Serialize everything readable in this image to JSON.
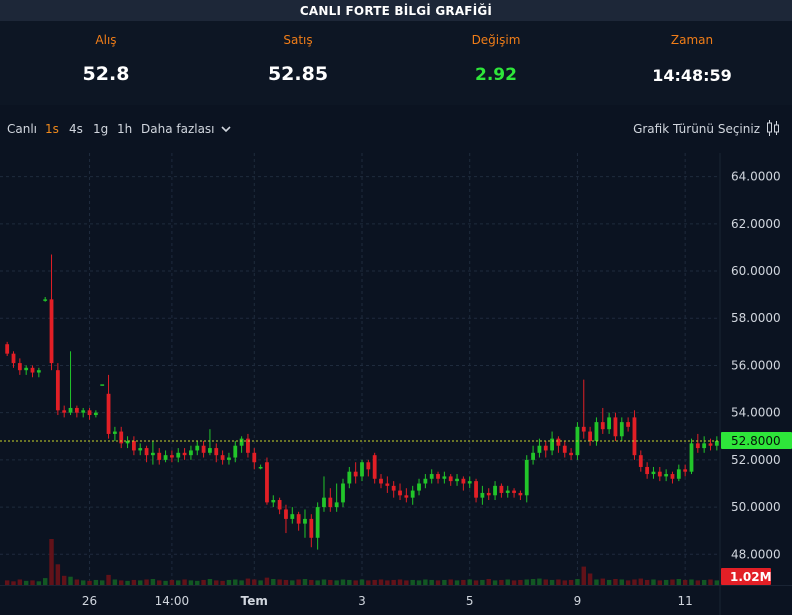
{
  "title": "CANLI FORTE BİLGİ GRAFİĞİ",
  "stats": [
    {
      "label": "Alış",
      "value": "52.8"
    },
    {
      "label": "Satış",
      "value": "52.85"
    },
    {
      "label": "Değişim",
      "value": "2.92"
    },
    {
      "label": "Zaman",
      "value": "14:48:59"
    }
  ],
  "toolbar": {
    "live": "Canlı",
    "intervals": [
      "1s",
      "4s",
      "1g",
      "1h"
    ],
    "active_interval": "1s",
    "more": "Daha fazlası",
    "chart_type": "Grafik Türünü Seçiniz"
  },
  "colors": {
    "up": "#22c52a",
    "down": "#e21f26",
    "accent": "#f07d18",
    "price_tag": "#2ee63a",
    "volume_tag": "#e21f26",
    "background": "#0b1321"
  },
  "icons": {
    "more": "chevron-down-icon",
    "chart_type": "candlestick-icon"
  },
  "chart_data": {
    "type": "candlestick",
    "y_ticks": [
      "64.0000",
      "62.0000",
      "60.0000",
      "58.0000",
      "56.0000",
      "54.0000",
      "52.0000",
      "50.0000",
      "48.0000"
    ],
    "ylim": [
      46.7,
      65.0
    ],
    "x_ticks": [
      "26",
      "14:00",
      "Tem",
      "3",
      "5",
      "9",
      "11"
    ],
    "x_tick_index": [
      13,
      26,
      39,
      56,
      73,
      90,
      107
    ],
    "last_price_label": "52.8000",
    "last_price": 52.8,
    "volume_label": "1.02M",
    "grid": true,
    "candles": [
      [
        56.9,
        56.5,
        57.0,
        56.4
      ],
      [
        56.5,
        56.1,
        56.6,
        55.9
      ],
      [
        56.1,
        55.8,
        56.3,
        55.6
      ],
      [
        55.8,
        55.9,
        56.0,
        55.6
      ],
      [
        55.9,
        55.7,
        56.0,
        55.5
      ],
      [
        55.7,
        55.8,
        55.9,
        55.5
      ],
      [
        58.8,
        58.8,
        58.9,
        58.7
      ],
      [
        58.8,
        56.1,
        60.7,
        55.8
      ],
      [
        55.8,
        54.1,
        56.1,
        53.9
      ],
      [
        54.1,
        54.0,
        54.3,
        53.8
      ],
      [
        54.0,
        54.2,
        56.6,
        53.9
      ],
      [
        54.2,
        54.0,
        54.3,
        53.8
      ],
      [
        54.0,
        54.1,
        54.2,
        53.8
      ],
      [
        54.1,
        53.9,
        54.2,
        53.7
      ],
      [
        53.9,
        54.0,
        54.1,
        53.8
      ],
      [
        55.2,
        55.2,
        55.2,
        55.2
      ],
      [
        54.8,
        53.1,
        55.6,
        52.9
      ],
      [
        53.1,
        53.2,
        53.4,
        52.8
      ],
      [
        53.2,
        52.7,
        53.4,
        52.5
      ],
      [
        52.7,
        52.8,
        53.0,
        52.5
      ],
      [
        52.8,
        52.4,
        53.0,
        52.2
      ],
      [
        52.4,
        52.5,
        52.7,
        52.2
      ],
      [
        52.5,
        52.2,
        52.6,
        51.9
      ],
      [
        52.2,
        52.3,
        52.8,
        51.8
      ],
      [
        52.3,
        52.0,
        52.5,
        51.8
      ],
      [
        52.0,
        52.2,
        52.4,
        51.9
      ],
      [
        52.2,
        52.1,
        52.4,
        51.9
      ],
      [
        52.1,
        52.3,
        52.5,
        51.9
      ],
      [
        52.3,
        52.2,
        52.5,
        52.0
      ],
      [
        52.2,
        52.4,
        52.6,
        52.0
      ],
      [
        52.4,
        52.6,
        52.8,
        52.2
      ],
      [
        52.6,
        52.3,
        52.8,
        52.1
      ],
      [
        52.3,
        52.5,
        53.3,
        52.2
      ],
      [
        52.5,
        52.2,
        52.7,
        51.9
      ],
      [
        52.2,
        52.0,
        52.4,
        51.8
      ],
      [
        52.0,
        52.1,
        52.3,
        51.8
      ],
      [
        52.1,
        52.6,
        52.8,
        51.9
      ],
      [
        52.6,
        52.9,
        53.0,
        52.3
      ],
      [
        52.9,
        52.3,
        53.1,
        52.1
      ],
      [
        52.3,
        51.9,
        52.5,
        51.6
      ],
      [
        51.7,
        51.7,
        51.8,
        51.6
      ],
      [
        51.9,
        50.2,
        52.1,
        50.1
      ],
      [
        50.2,
        50.3,
        50.5,
        50.0
      ],
      [
        50.3,
        49.9,
        50.4,
        49.7
      ],
      [
        49.9,
        49.5,
        50.1,
        48.9
      ],
      [
        49.5,
        49.7,
        50.0,
        49.3
      ],
      [
        49.7,
        49.3,
        49.8,
        49.0
      ],
      [
        49.3,
        49.5,
        49.9,
        48.7
      ],
      [
        49.5,
        48.7,
        49.7,
        48.3
      ],
      [
        48.7,
        50.0,
        50.2,
        48.2
      ],
      [
        50.0,
        50.4,
        51.3,
        49.8
      ],
      [
        50.4,
        50.0,
        50.8,
        49.8
      ],
      [
        50.0,
        50.2,
        51.0,
        49.8
      ],
      [
        50.2,
        51.0,
        51.2,
        50.0
      ],
      [
        51.0,
        51.5,
        51.7,
        50.8
      ],
      [
        51.5,
        51.3,
        51.9,
        51.0
      ],
      [
        51.3,
        51.9,
        52.0,
        51.1
      ],
      [
        51.9,
        51.6,
        52.0,
        51.3
      ],
      [
        52.2,
        51.2,
        52.3,
        51.0
      ],
      [
        51.2,
        51.0,
        51.4,
        50.8
      ],
      [
        51.0,
        50.9,
        51.3,
        50.6
      ],
      [
        50.9,
        50.7,
        51.1,
        50.4
      ],
      [
        50.7,
        50.5,
        51.0,
        50.3
      ],
      [
        50.5,
        50.4,
        50.8,
        50.2
      ],
      [
        50.4,
        50.7,
        50.9,
        50.1
      ],
      [
        50.7,
        51.0,
        51.2,
        50.5
      ],
      [
        51.0,
        51.2,
        51.4,
        50.8
      ],
      [
        51.2,
        51.4,
        51.6,
        51.0
      ],
      [
        51.4,
        51.2,
        51.5,
        51.0
      ],
      [
        51.2,
        51.3,
        51.5,
        51.0
      ],
      [
        51.3,
        51.1,
        51.4,
        50.9
      ],
      [
        51.1,
        51.2,
        51.4,
        50.9
      ],
      [
        51.2,
        51.0,
        51.3,
        50.7
      ],
      [
        51.0,
        51.1,
        51.3,
        50.8
      ],
      [
        51.1,
        50.4,
        51.2,
        50.2
      ],
      [
        50.4,
        50.6,
        50.9,
        50.1
      ],
      [
        50.6,
        50.5,
        50.8,
        50.3
      ],
      [
        50.5,
        50.9,
        51.1,
        50.3
      ],
      [
        50.9,
        50.6,
        51.0,
        50.4
      ],
      [
        50.6,
        50.7,
        50.9,
        50.4
      ],
      [
        50.7,
        50.6,
        50.8,
        50.4
      ],
      [
        50.6,
        50.5,
        50.7,
        50.3
      ],
      [
        50.5,
        52.0,
        52.2,
        50.2
      ],
      [
        52.0,
        52.3,
        52.6,
        51.8
      ],
      [
        52.3,
        52.6,
        52.9,
        52.1
      ],
      [
        52.6,
        52.4,
        52.8,
        52.1
      ],
      [
        52.4,
        52.9,
        53.2,
        52.2
      ],
      [
        52.9,
        52.6,
        53.0,
        52.3
      ],
      [
        52.6,
        52.3,
        52.8,
        52.1
      ],
      [
        52.3,
        52.2,
        52.5,
        52.0
      ],
      [
        52.2,
        53.4,
        53.6,
        52.0
      ],
      [
        53.4,
        53.2,
        55.4,
        52.9
      ],
      [
        53.2,
        52.8,
        53.4,
        52.6
      ],
      [
        52.8,
        53.6,
        53.8,
        52.6
      ],
      [
        53.6,
        53.3,
        54.2,
        53.1
      ],
      [
        53.3,
        53.8,
        54.0,
        53.1
      ],
      [
        53.8,
        53.0,
        54.0,
        52.8
      ],
      [
        53.0,
        53.6,
        53.8,
        52.8
      ],
      [
        53.6,
        53.4,
        53.8,
        53.2
      ],
      [
        53.8,
        52.2,
        54.1,
        52.0
      ],
      [
        52.2,
        51.7,
        52.4,
        51.5
      ],
      [
        51.7,
        51.4,
        51.9,
        51.2
      ],
      [
        51.4,
        51.5,
        51.7,
        51.2
      ],
      [
        51.5,
        51.3,
        51.7,
        51.1
      ],
      [
        51.3,
        51.4,
        51.6,
        51.1
      ],
      [
        51.4,
        51.2,
        51.5,
        51.0
      ],
      [
        51.2,
        51.6,
        51.8,
        51.1
      ],
      [
        51.6,
        51.5,
        51.8,
        51.3
      ],
      [
        51.5,
        52.7,
        52.9,
        51.4
      ],
      [
        52.7,
        52.5,
        53.1,
        52.3
      ],
      [
        52.5,
        52.7,
        53.0,
        52.3
      ],
      [
        52.7,
        52.6,
        52.9,
        52.4
      ],
      [
        52.6,
        52.8,
        53.0,
        52.4
      ]
    ],
    "volumes": [
      0.1,
      0.08,
      0.12,
      0.09,
      0.1,
      0.08,
      0.15,
      1.0,
      0.45,
      0.2,
      0.18,
      0.12,
      0.1,
      0.09,
      0.11,
      0.1,
      0.22,
      0.12,
      0.1,
      0.09,
      0.11,
      0.1,
      0.12,
      0.13,
      0.1,
      0.09,
      0.11,
      0.1,
      0.12,
      0.1,
      0.09,
      0.11,
      0.13,
      0.1,
      0.09,
      0.11,
      0.12,
      0.1,
      0.14,
      0.12,
      0.1,
      0.16,
      0.13,
      0.12,
      0.11,
      0.1,
      0.12,
      0.13,
      0.11,
      0.1,
      0.12,
      0.11,
      0.1,
      0.12,
      0.11,
      0.1,
      0.12,
      0.1,
      0.11,
      0.12,
      0.1,
      0.11,
      0.12,
      0.1,
      0.11,
      0.1,
      0.12,
      0.11,
      0.1,
      0.11,
      0.12,
      0.1,
      0.11,
      0.12,
      0.1,
      0.11,
      0.13,
      0.1,
      0.11,
      0.12,
      0.1,
      0.11,
      0.12,
      0.13,
      0.14,
      0.12,
      0.11,
      0.12,
      0.1,
      0.11,
      0.13,
      0.4,
      0.25,
      0.12,
      0.14,
      0.11,
      0.13,
      0.12,
      0.1,
      0.12,
      0.14,
      0.11,
      0.12,
      0.1,
      0.11,
      0.12,
      0.13,
      0.11,
      0.12,
      0.1,
      0.11,
      0.12,
      0.1
    ]
  }
}
